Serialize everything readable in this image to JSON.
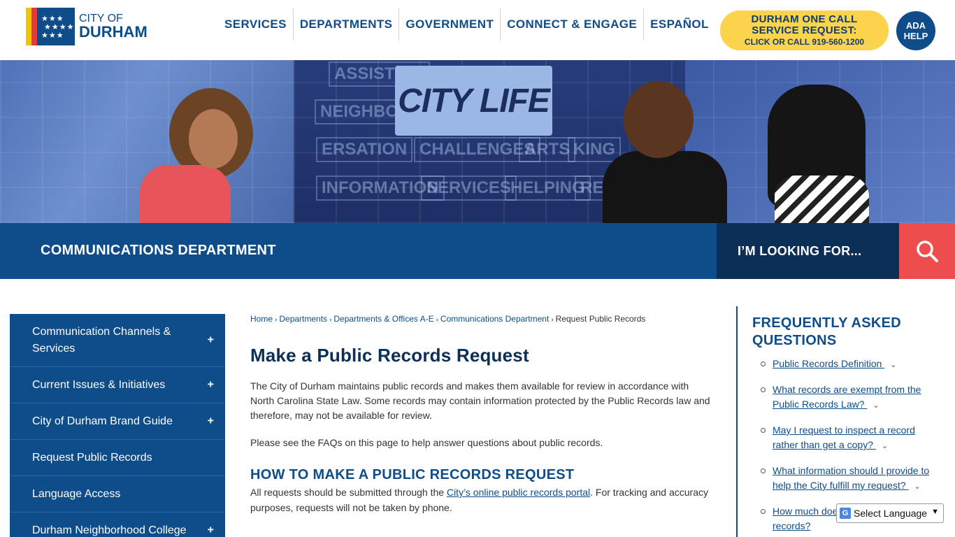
{
  "logo": {
    "line1": "CITY OF",
    "line2": "DURHAM",
    "stars": "★ ★ ★\n★ ★ ★ ★\n★ ★ ★ ★"
  },
  "nav": [
    {
      "label": "SERVICES"
    },
    {
      "label": "DEPARTMENTS"
    },
    {
      "label": "GOVERNMENT"
    },
    {
      "label": "CONNECT & ENGAGE"
    },
    {
      "label": "ESPAÑOL"
    }
  ],
  "onecall": {
    "line1": "DURHAM ONE CALL",
    "line2": "SERVICE REQUEST:",
    "line3": "CLICK OR CALL 919-560-1200"
  },
  "ada": {
    "line1": "ADA",
    "line2": "HELP"
  },
  "banner": {
    "bubble_text": "CITY LIFE",
    "tiles": [
      "ASSISTING",
      "NEIGHBORH",
      "ERSATION",
      "CHALLENGES",
      "ARTS",
      "KING",
      "INFORMATION",
      "SERVICES",
      "HELPING",
      "RES"
    ]
  },
  "department": {
    "title": "COMMUNICATIONS DEPARTMENT"
  },
  "search": {
    "placeholder": "I’M LOOKING FOR..."
  },
  "sidebar": {
    "items": [
      {
        "label": "Communication Channels & Services",
        "expandable": true
      },
      {
        "label": "Current Issues & Initiatives",
        "expandable": true
      },
      {
        "label": "City of Durham Brand Guide",
        "expandable": true
      },
      {
        "label": "Request Public Records",
        "expandable": false
      },
      {
        "label": "Language Access",
        "expandable": false
      },
      {
        "label": "Durham Neighborhood College",
        "expandable": true
      }
    ],
    "plus_symbol": "+"
  },
  "breadcrumb": {
    "items": [
      "Home",
      "Departments",
      "Departments & Offices A-E",
      "Communications Department"
    ],
    "current": "Request Public Records",
    "separator": "›"
  },
  "main": {
    "title": "Make a Public Records Request",
    "intro": "The City of Durham maintains public records and makes them available for review in accordance with North Carolina State Law. Some records may contain information protected by the Public Records law and therefore, may not be available for review.",
    "faq_note": "Please see the FAQs on this page to help answer questions about public records.",
    "subheading": "HOW TO MAKE A PUBLIC RECORDS REQUEST",
    "how_before": "All requests should be submitted through the ",
    "how_link": "City’s online public records portal",
    "how_after": ". For tracking and accuracy purposes, requests will not be taken by phone."
  },
  "faq": {
    "heading": "FREQUENTLY ASKED QUESTIONS",
    "items": [
      {
        "label": "Public Records Definition "
      },
      {
        "label": "What records are exempt from the Public Records Law? "
      },
      {
        "label": "May I request to inspect a record rather than get a copy? "
      },
      {
        "label": "What information should I provide to help the City fulfill my request? "
      },
      {
        "label": "How much does it cost to obtain public records? "
      }
    ],
    "chevron": "⌄"
  },
  "translate": {
    "g": "G",
    "label": "Select Language",
    "arrow": "▼"
  }
}
